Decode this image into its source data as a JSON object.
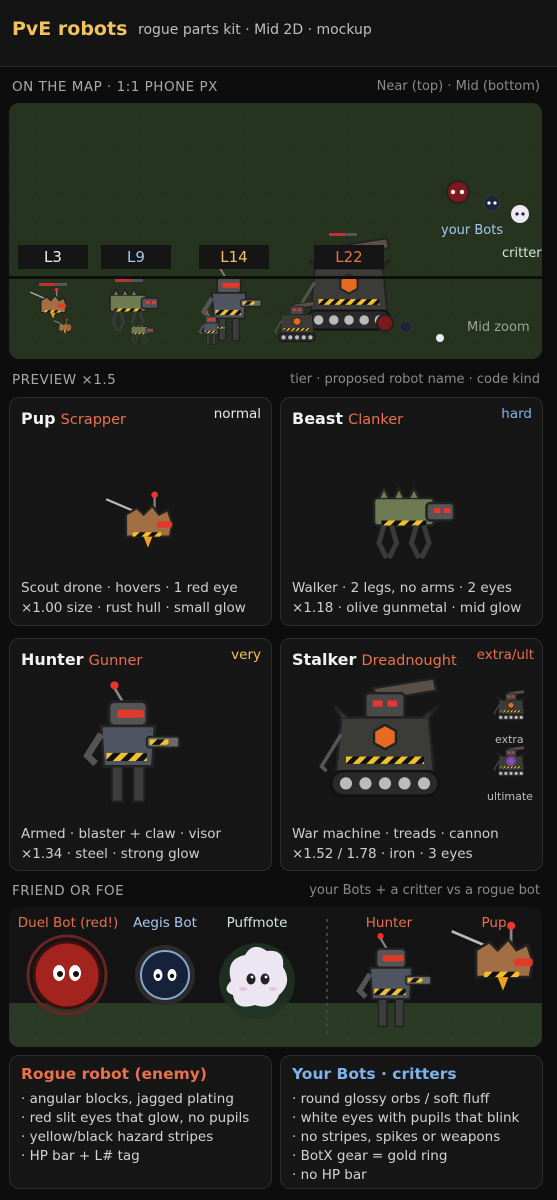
{
  "header": {
    "title": "PvE robots",
    "subtitle": "rogue parts kit · Mid 2D · mockup"
  },
  "map": {
    "section_title": "ON THE MAP · 1:1 PHONE PX",
    "section_note": "Near (top) · Mid (bottom)",
    "levels": [
      {
        "label": "L3",
        "color": "#e9e9e9"
      },
      {
        "label": "L9",
        "color": "#a9c8f0"
      },
      {
        "label": "L14",
        "color": "#f0c262"
      },
      {
        "label": "L22",
        "color": "#e8714e"
      }
    ],
    "your_bots_label": "your Bots",
    "critter_label": "critter",
    "mid_zoom_label": "Mid zoom"
  },
  "preview": {
    "section_title": "PREVIEW ×1.5",
    "section_note": "tier · proposed robot name · code kind",
    "cards": [
      {
        "title": "Pup",
        "kind": "Scrapper",
        "tier": "normal",
        "tier_color": "#e9e9e9",
        "desc1": "Scout drone · hovers · 1 red eye",
        "desc2": "×1.00 size · rust hull · small glow"
      },
      {
        "title": "Beast",
        "kind": "Clanker",
        "tier": "hard",
        "tier_color": "#7fb2ea",
        "desc1": "Walker · 2 legs, no arms · 2 eyes",
        "desc2": "×1.18 · olive gunmetal · mid glow"
      },
      {
        "title": "Hunter",
        "kind": "Gunner",
        "tier": "very",
        "tier_color": "#f0c262",
        "desc1": "Armed · blaster + claw · visor",
        "desc2": "×1.34 · steel · strong glow"
      },
      {
        "title": "Stalker",
        "kind": "Dreadnought",
        "tier": "extra/ult",
        "tier_color": "#e8714e",
        "desc1": "War machine · treads · cannon",
        "desc2": "×1.52 / 1.78 · iron · 3 eyes",
        "extra_label": "extra",
        "ultimate_label": "ultimate"
      }
    ]
  },
  "friend_or_foe": {
    "section_title": "FRIEND OR FOE",
    "section_note": "your Bots + a critter vs a rogue bot",
    "labels": [
      {
        "text": "Duel Bot (red!)",
        "color": "#e8714e"
      },
      {
        "text": "Aegis Bot",
        "color": "#a9c8f0"
      },
      {
        "text": "Puffmote",
        "color": "#cfe8d8"
      },
      {
        "text": "Hunter",
        "color": "#e8714e"
      },
      {
        "text": "Pup",
        "color": "#e8714e"
      }
    ]
  },
  "rogue_list": {
    "title": "Rogue robot (enemy)",
    "title_color": "#e8714e",
    "items": [
      "· angular blocks, jagged plating",
      "· red slit eyes that glow, no pupils",
      "· yellow/black hazard stripes",
      "· HP bar + L# tag"
    ]
  },
  "bots_list": {
    "title": "Your Bots · critters",
    "title_color": "#7fb2ea",
    "items": [
      "· round glossy orbs / soft fluff",
      "· white eyes with pupils that blink",
      "· no stripes, spikes or weapons",
      "· BotX gear = gold ring",
      "· no HP bar"
    ]
  }
}
